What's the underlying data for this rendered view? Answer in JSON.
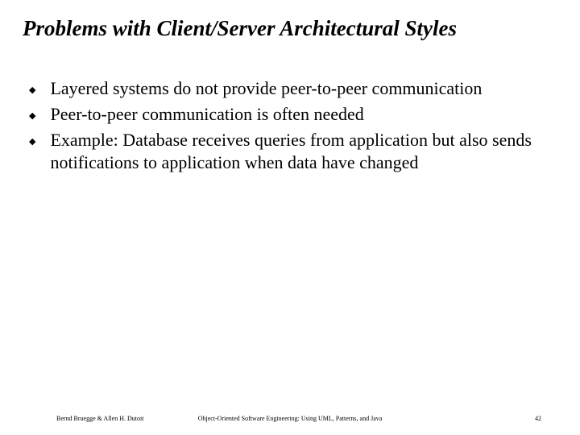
{
  "title": "Problems with Client/Server Architectural Styles",
  "bullets": [
    "Layered systems do not provide peer-to-peer communication",
    "Peer-to-peer communication is often needed",
    "Example: Database receives queries  from application but also sends notifications to application when data have changed"
  ],
  "bullet_glyph": "◆",
  "footer": {
    "left": "Bernd Bruegge & Allen H. Dutoit",
    "center": "Object-Oriented Software Engineering: Using UML, Patterns, and Java",
    "right": "42"
  }
}
